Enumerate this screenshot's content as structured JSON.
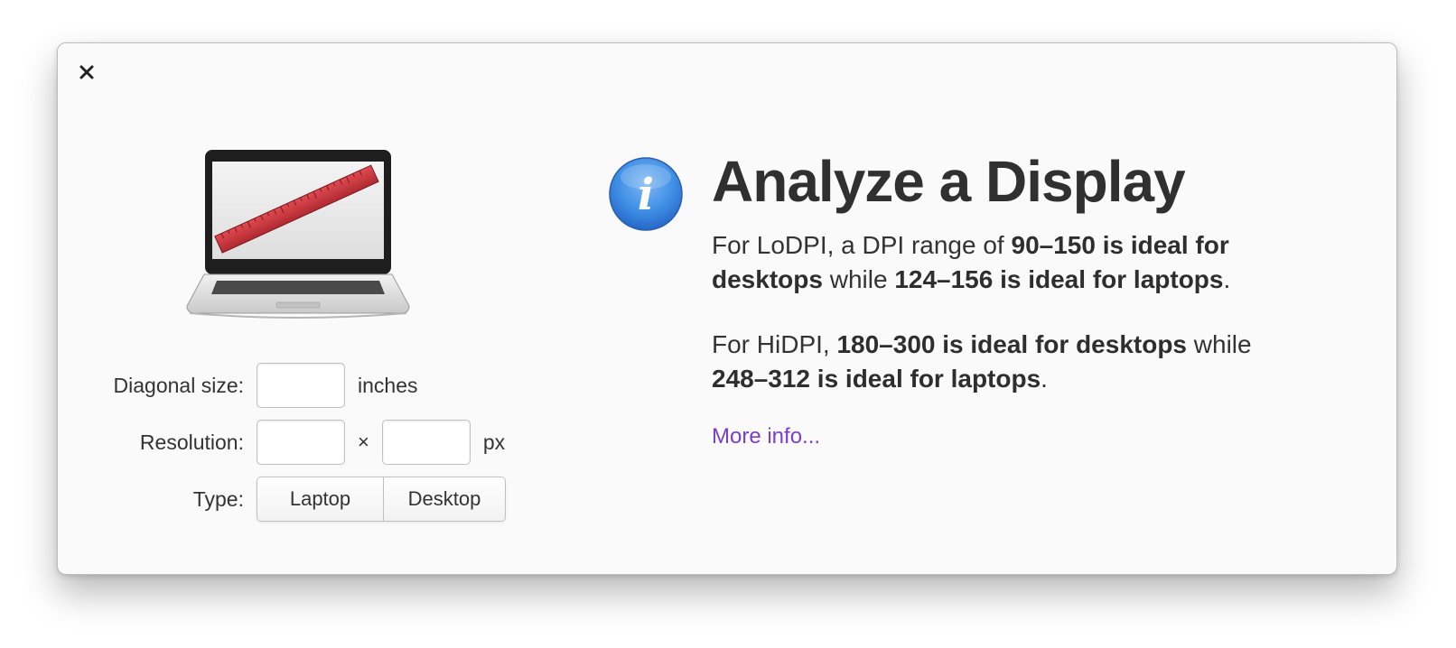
{
  "dialog": {
    "close_icon": "close-icon",
    "close_glyph": "✕"
  },
  "illustration": {
    "icon": "laptop-with-ruler-icon"
  },
  "form": {
    "diagonal_label": "Diagonal size:",
    "diagonal_value": "",
    "diagonal_unit": "inches",
    "resolution_label": "Resolution:",
    "resolution_width_value": "",
    "resolution_times": "×",
    "resolution_height_value": "",
    "resolution_unit": "px",
    "type_label": "Type:",
    "type_options": [
      "Laptop",
      "Desktop"
    ]
  },
  "info": {
    "icon": "info-icon",
    "icon_glyph": "i",
    "title": "Analyze a Display",
    "para1": {
      "t1": "For LoDPI, a DPI range of ",
      "b1": "90–150 is ideal for desktops",
      "t2": " while ",
      "b2": "124–156 is ideal for laptops",
      "t3": "."
    },
    "para2": {
      "t1": "For HiDPI, ",
      "b1": "180–300 is ideal for desktops",
      "t2": " while ",
      "b2": "248–312 is ideal for laptops",
      "t3": "."
    },
    "more_link": "More info..."
  },
  "colors": {
    "link": "#7a3ec8",
    "info_blue": "#3f8fe6",
    "ruler_red": "#c8353c",
    "dialog_bg": "#fafafa"
  }
}
